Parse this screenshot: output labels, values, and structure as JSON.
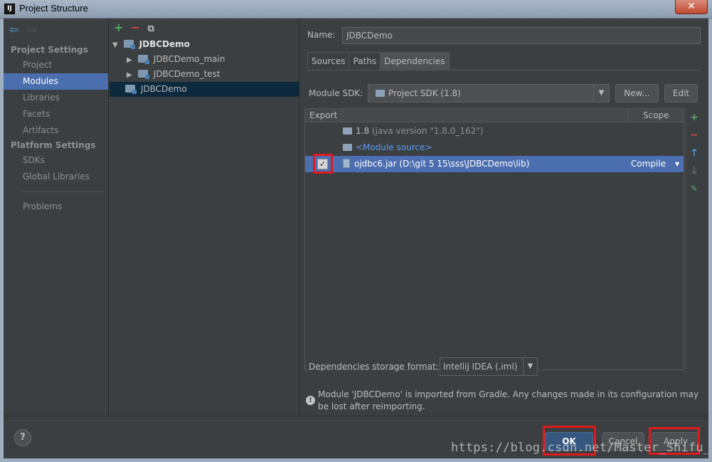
{
  "window": {
    "title": "Project Structure",
    "app_icon_text": "IJ",
    "close_glyph": "✕"
  },
  "nav": {
    "back_icon": "arrow-left-icon",
    "forward_icon": "arrow-right-icon",
    "project_settings_heading": "Project Settings",
    "project_settings_items": [
      "Project",
      "Modules",
      "Libraries",
      "Facets",
      "Artifacts"
    ],
    "selected_item": "Modules",
    "platform_settings_heading": "Platform Settings",
    "platform_settings_items": [
      "SDKs",
      "Global Libraries"
    ],
    "problems": "Problems"
  },
  "tree": {
    "root": "JDBCDemo",
    "children": [
      "JDBCDemo_main",
      "JDBCDemo_test"
    ],
    "selected_module": "JDBCDemo"
  },
  "module": {
    "name_label": "Name:",
    "name_value": "JDBCDemo",
    "tabs": [
      "Sources",
      "Paths",
      "Dependencies"
    ],
    "active_tab": "Dependencies",
    "sdk_label": "Module SDK:",
    "sdk_value": "Project SDK (1.8)",
    "new_button": "New...",
    "edit_button": "Edit"
  },
  "dependencies": {
    "col_export": "Export",
    "col_scope": "Scope",
    "rows": [
      {
        "name": "1.8",
        "detail": "(java version \"1.8.0_162\")"
      },
      {
        "name": "<Module source>"
      },
      {
        "name": "ojdbc6.jar",
        "detail": "(D:\\git 5 15\\sss\\JDBCDemo\\lib)",
        "scope": "Compile",
        "export_checked": true
      }
    ],
    "storage_label": "Dependencies storage format:",
    "storage_value": "IntelliJ IDEA (.iml)"
  },
  "notice": "Module 'JDBCDemo' is imported from Gradle. Any changes made in its configuration may be lost after reimporting.",
  "buttons": {
    "help": "?",
    "ok": "OK",
    "cancel": "Cancel",
    "apply": "Apply"
  },
  "watermark": "https://blog.csdn.net/Master_Shifu_",
  "colors": {
    "selection": "#4b6eaf",
    "highlight": "#e0191d",
    "background": "#3c3f41"
  }
}
